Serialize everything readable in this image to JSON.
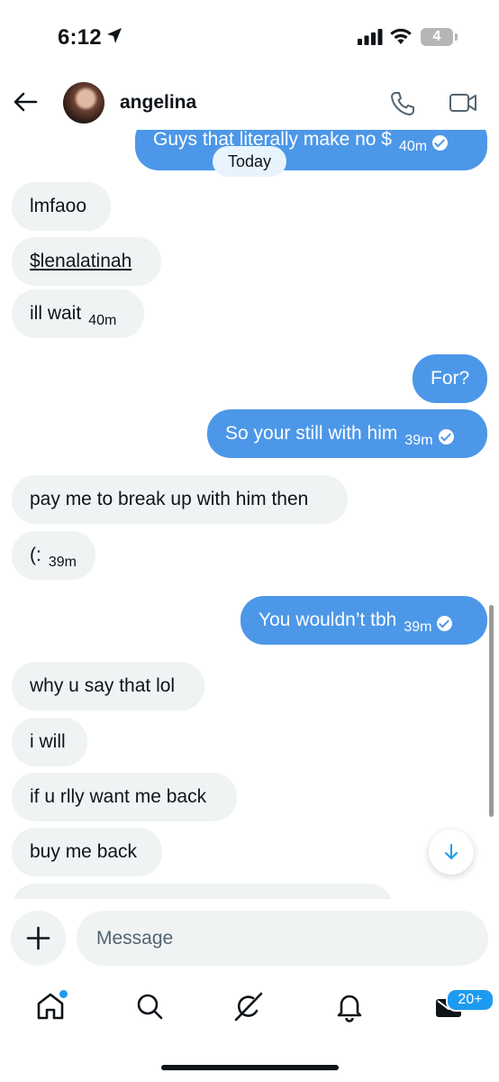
{
  "status_bar": {
    "time": "6:12",
    "battery": "4"
  },
  "header": {
    "contact_name": "angelina"
  },
  "chat": {
    "date_divider": "Today",
    "messages": [
      {
        "dir": "out",
        "text": "Guys that literally make no $",
        "time": "40m",
        "read": true
      },
      {
        "dir": "in",
        "text": "lmfaoo"
      },
      {
        "dir": "in",
        "text": "$lenalatinah",
        "link": true
      },
      {
        "dir": "in",
        "text": "ill wait",
        "time": "40m"
      },
      {
        "dir": "out",
        "text": "For?"
      },
      {
        "dir": "out",
        "text": "So your still with him",
        "time": "39m",
        "read": true
      },
      {
        "dir": "in",
        "text": "pay me to break up with him then"
      },
      {
        "dir": "in",
        "text": "(:",
        "time": "39m"
      },
      {
        "dir": "out",
        "text": "You wouldn’t tbh",
        "time": "39m",
        "read": true
      },
      {
        "dir": "in",
        "text": "why u say that lol"
      },
      {
        "dir": "in",
        "text": "i will"
      },
      {
        "dir": "in",
        "text": "if u rlly want me back"
      },
      {
        "dir": "in",
        "text": "buy me back"
      }
    ]
  },
  "composer": {
    "placeholder": "Message"
  },
  "tabbar": {
    "messages_badge": "20+"
  },
  "icons": [
    "location-arrow-icon",
    "signal-icon",
    "wifi-icon",
    "back-arrow-icon",
    "phone-icon",
    "video-icon",
    "arrow-down-icon",
    "plus-icon",
    "home-icon",
    "search-icon",
    "grok-icon",
    "bell-icon",
    "mail-icon"
  ],
  "colors": {
    "outgoing_bubble": "#4c97e8",
    "incoming_bubble": "#eff3f4",
    "accent": "#1d9bf0"
  }
}
